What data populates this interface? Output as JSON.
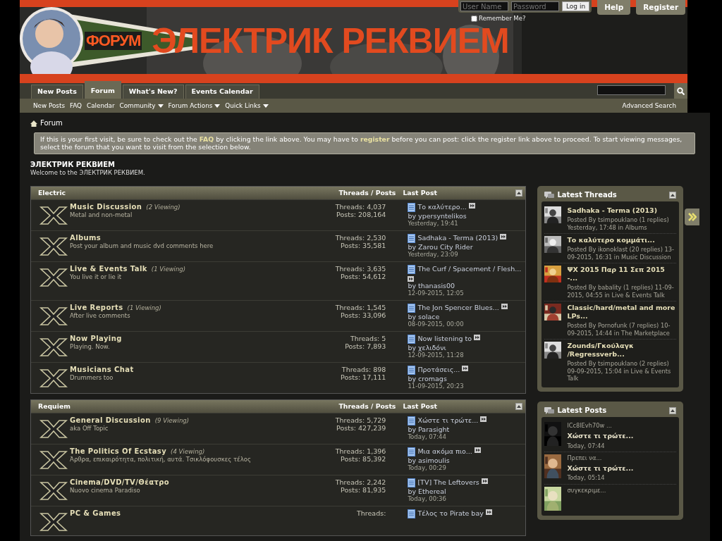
{
  "header": {
    "logo_small": "ФОРУМ",
    "logo": "ЭЛЕКТРИК РЕКВИЕМ",
    "login": {
      "username_placeholder": "User Name",
      "password_placeholder": "Password",
      "button": "Log in",
      "remember_label": "Remember Me?",
      "remember_checked": false
    },
    "buttons": [
      "Help",
      "Register"
    ]
  },
  "tabs": [
    {
      "label": "New Posts",
      "selected": false
    },
    {
      "label": "Forum",
      "selected": true
    },
    {
      "label": "What's New?",
      "selected": false
    },
    {
      "label": "Events Calendar",
      "selected": false
    }
  ],
  "subnav": [
    {
      "label": "New Posts",
      "dropdown": false
    },
    {
      "label": "FAQ",
      "dropdown": false
    },
    {
      "label": "Calendar",
      "dropdown": false
    },
    {
      "label": "Community",
      "dropdown": true
    },
    {
      "label": "Forum Actions",
      "dropdown": true
    },
    {
      "label": "Quick Links",
      "dropdown": true
    }
  ],
  "advanced_search": "Advanced Search",
  "breadcrumb": "Forum",
  "notice": [
    {
      "kind": "text",
      "text": "If this is your first visit, be sure to check out the "
    },
    {
      "kind": "link",
      "text": "FAQ"
    },
    {
      "kind": "text",
      "text": " by clicking the link above. You may have to "
    },
    {
      "kind": "link",
      "text": "register"
    },
    {
      "kind": "text",
      "text": " before you can post: click the register link above to proceed. To start viewing messages, select the forum that you want to visit from the selection below."
    }
  ],
  "site_title": "ЭЛЕКТРИК РЕКВИЕМ",
  "welcome": "Welcome to the ЭЛЕКТРИК РЕКВИЕМ.",
  "categories": [
    {
      "title": "Electric",
      "col_stats": "Threads / Posts",
      "col_last": "Last Post",
      "forums": [
        {
          "title": "Music Discussion",
          "viewing": "(2 Viewing)",
          "description": "Metal and non-metal",
          "threads": "Threads: 4,037",
          "posts": "Posts: 208,164",
          "last_title": "Το καλύτερο...",
          "last_by": "by ypersyntelikos",
          "last_date": "Yesterday, 19:41"
        },
        {
          "title": "Albums",
          "description": "Post your album and music dvd comments here",
          "threads": "Threads: 2,530",
          "posts": "Posts: 35,581",
          "last_title": "Sadhaka - Terma (2013)",
          "last_by": "by Zarou City Rider",
          "last_date": "Yesterday, 23:09"
        },
        {
          "title": "Live & Events Talk",
          "viewing": "(1 Viewing)",
          "description": "You live it or lie it",
          "threads": "Threads: 3,635",
          "posts": "Posts: 54,612",
          "last_title": "The Curf / Spacement / Flesh...",
          "last_by": "by thanasis00",
          "last_date": "12-09-2015, 12:05"
        },
        {
          "title": "Live Reports",
          "viewing": "(1 Viewing)",
          "description": "After live comments",
          "threads": "Threads: 1,545",
          "posts": "Posts: 33,096",
          "last_title": "The Jon Spencer Blues...",
          "last_by": "by solace",
          "last_date": "08-09-2015, 00:00"
        },
        {
          "title": "Now Playing",
          "description": "Playing. Now.",
          "threads": "Threads: 5",
          "posts": "Posts: 7,893",
          "last_title": "Now listening to",
          "last_by": "by χελιδόνι",
          "last_date": "12-09-2015, 11:28"
        },
        {
          "title": "Musicians Chat",
          "description": "Drummers too",
          "threads": "Threads: 898",
          "posts": "Posts: 17,111",
          "last_title": "Προτάσεις...",
          "last_by": "by cromags",
          "last_date": "11-09-2015, 20:23"
        }
      ]
    },
    {
      "title": "Requiem",
      "col_stats": "Threads / Posts",
      "col_last": "Last Post",
      "forums": [
        {
          "title": "General Discussion",
          "viewing": "(9 Viewing)",
          "description": "aka Off Topic",
          "threads": "Threads: 5,729",
          "posts": "Posts: 427,239",
          "last_title": "Χώστε τι τρώτε...",
          "last_by": "by Parasight",
          "last_date": "Today, 07:44"
        },
        {
          "title": "The Politics Of Ecstasy",
          "viewing": "(4 Viewing)",
          "description": "Άρθρα, επικαιρότητα, πολιτική, αυτά. Τσικλόφουσκες τέλος",
          "threads": "Threads: 1,396",
          "posts": "Posts: 85,392",
          "last_title": "Μια ακόμα πιο...",
          "last_by": "by asimoulis",
          "last_date": "Today, 00:29"
        },
        {
          "title": "Cinema/DVD/TV/Θέατρο",
          "description": "Nuovo cinema Paradiso",
          "threads": "Threads: 2,242",
          "posts": "Posts: 81,935",
          "last_title": "[TV] The Leftovers",
          "last_by": "by Ethereal",
          "last_date": "Today, 00:36"
        },
        {
          "title": "PC & Games",
          "threads": "Threads:",
          "last_title": "Τέλος το Pirate bay"
        }
      ]
    }
  ],
  "latest_threads": {
    "title": "Latest Threads",
    "items": [
      {
        "title": "Sadhaka - Terma (2013)",
        "meta": "Posted By tsimpouklano (1 replies) Yesterday, 17:48 in Albums"
      },
      {
        "title": "Το καλύτερο κομμάτι...",
        "meta": "Posted By ikonoklast (20 replies) 13-09-2015, 16:31 in Music Discussion"
      },
      {
        "title": "ΨΧ 2015 Παρ 11 Σεπ 2015 -...",
        "meta": "Posted By babality (1 replies) 11-09-2015, 04:55 in Live & Events Talk"
      },
      {
        "title": "Classic/hard/metal and more LPs...",
        "meta": "Posted By Pornofunk (7 replies) 10-09-2015, 14:44 in The Marketplace"
      },
      {
        "title": "Zounds/Γκούλαγκ /Regressverb...",
        "meta": "Posted By tsimpouklano (2 replies) 09-09-2015, 15:04 in Live & Events Talk"
      }
    ]
  },
  "latest_posts": {
    "title": "Latest Posts",
    "items": [
      {
        "snippet": "lCc8lEvh70w ...",
        "thread": "Χώστε τι τρώτε...",
        "date": "Today, 07:44"
      },
      {
        "snippet": "Πρεπει να...",
        "thread": "Χώστε τι τρώτε...",
        "date": "Today, 05:14"
      },
      {
        "snippet": "συγκεκριμε..."
      }
    ]
  }
}
